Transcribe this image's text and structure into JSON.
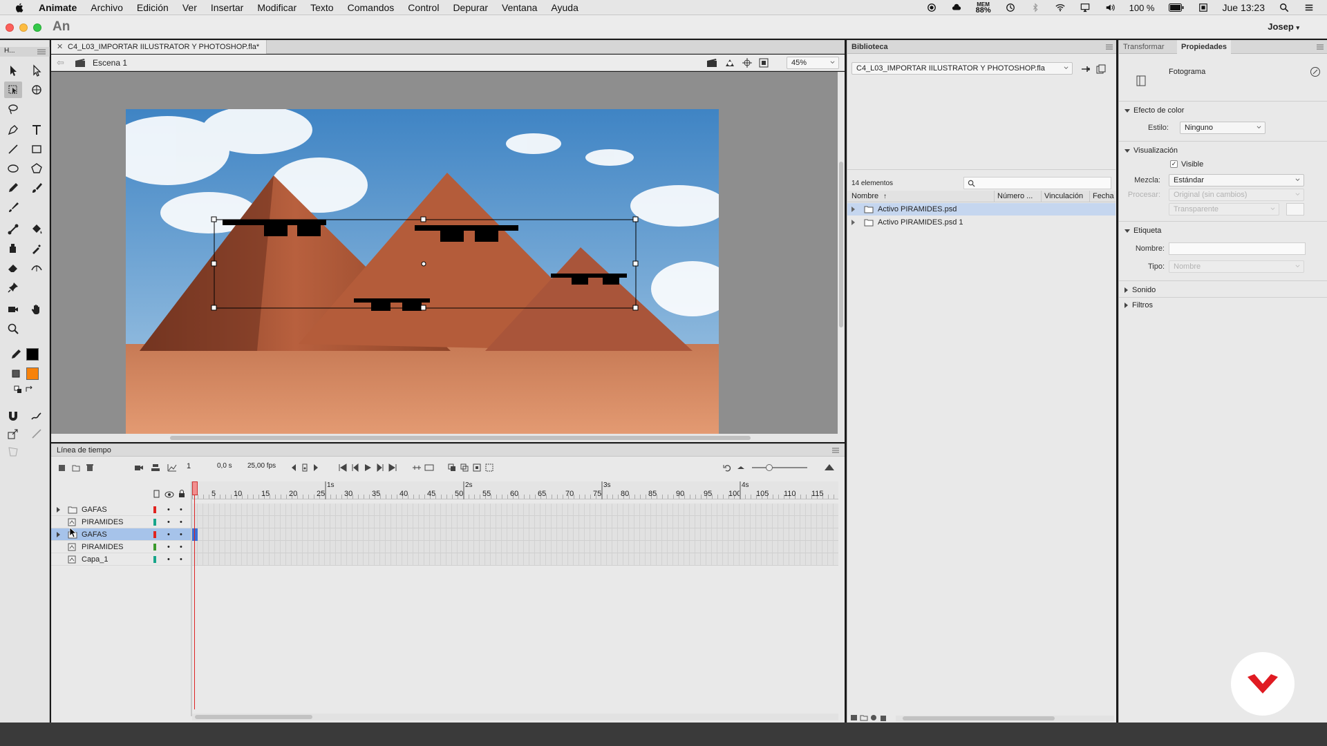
{
  "menubar": {
    "app_name": "Animate",
    "items": [
      "Archivo",
      "Edición",
      "Ver",
      "Insertar",
      "Modificar",
      "Texto",
      "Comandos",
      "Control",
      "Depurar",
      "Ventana",
      "Ayuda"
    ],
    "mem_label": "MEM",
    "mem_value": "88%",
    "battery": "100 %",
    "clock": "Jue 13:23"
  },
  "window": {
    "app_logo": "An",
    "user": "Josep",
    "tools_header": "H..."
  },
  "document": {
    "tab_title": "C4_L03_IMPORTAR IILUSTRATOR Y PHOTOSHOP.fla*",
    "scene": "Escena 1",
    "zoom": "45%"
  },
  "timeline": {
    "title": "Línea de tiempo",
    "current_frame": "1",
    "time": "0,0 s",
    "fps": "25,00 fps",
    "ruler_ticks": [
      "5",
      "10",
      "15",
      "20",
      "25",
      "30",
      "35",
      "40",
      "45",
      "50",
      "55",
      "60",
      "65",
      "70",
      "75",
      "80",
      "85",
      "90",
      "95",
      "100",
      "105",
      "110",
      "115"
    ],
    "second_marks": [
      "1s",
      "2s",
      "3s",
      "4s"
    ],
    "layers": [
      {
        "name": "GAFAS",
        "type": "folder",
        "color": "#e0241f",
        "selected": false
      },
      {
        "name": "PIRAMIDES",
        "type": "layer",
        "color": "#17a58a",
        "selected": false
      },
      {
        "name": "GAFAS",
        "type": "folder",
        "color": "#e0241f",
        "selected": true
      },
      {
        "name": "PIRAMIDES",
        "type": "layer",
        "color": "#3a9a2c",
        "selected": false
      },
      {
        "name": "Capa_1",
        "type": "layer",
        "color": "#17a58a",
        "selected": false
      }
    ]
  },
  "library": {
    "title": "Biblioteca",
    "document": "C4_L03_IMPORTAR IILUSTRATOR Y PHOTOSHOP.fla",
    "count": "14 elementos",
    "columns": [
      "Nombre",
      "Número ...",
      "Vinculación",
      "Fecha"
    ],
    "items": [
      {
        "name": "Activo PIRAMIDES.psd",
        "selected": true
      },
      {
        "name": "Activo PIRAMIDES.psd 1",
        "selected": false
      }
    ]
  },
  "properties": {
    "tabs": [
      "Transformar",
      "Propiedades"
    ],
    "object_type": "Fotograma",
    "sections": {
      "color_effect": "Efecto de color",
      "display": "Visualización",
      "label": "Etiqueta",
      "sound": "Sonido",
      "filters": "Filtros"
    },
    "style_label": "Estilo:",
    "style_value": "Ninguno",
    "visible_label": "Visible",
    "visible_checked": true,
    "blend_label": "Mezcla:",
    "blend_value": "Estándar",
    "render_label": "Procesar:",
    "render_value": "Original (sin cambios)",
    "transparent_value": "Transparente",
    "name_label": "Nombre:",
    "type_label": "Tipo:",
    "type_value": "Nombre"
  }
}
